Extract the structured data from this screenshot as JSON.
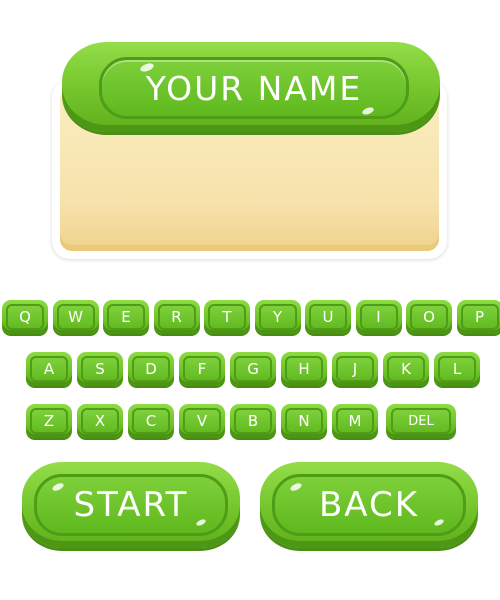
{
  "name_panel": {
    "title": "YOUR NAME",
    "input_value": ""
  },
  "keyboard": {
    "row1": [
      "Q",
      "W",
      "E",
      "R",
      "T",
      "Y",
      "U",
      "I",
      "O",
      "P"
    ],
    "row2": [
      "A",
      "S",
      "D",
      "F",
      "G",
      "H",
      "J",
      "K",
      "L"
    ],
    "row3": [
      "Z",
      "X",
      "C",
      "V",
      "B",
      "N",
      "M"
    ],
    "delete_label": "DEL"
  },
  "buttons": {
    "start_label": "START",
    "back_label": "BACK"
  },
  "colors": {
    "button_green": "#74c52b",
    "button_dark_green": "#4f9d17",
    "panel_cream": "#f6e2ab"
  }
}
